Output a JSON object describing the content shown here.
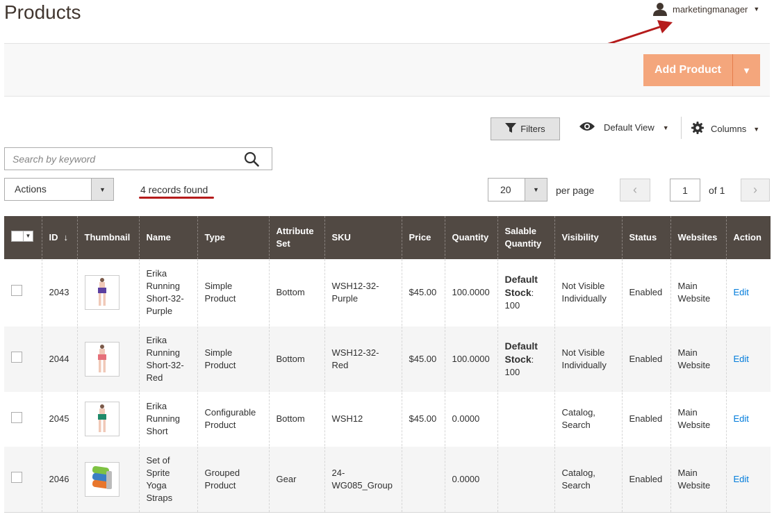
{
  "header": {
    "title": "Products",
    "username": "marketingmanager"
  },
  "actionbar": {
    "add_product_label": "Add Product"
  },
  "toolbar": {
    "filters_label": "Filters",
    "view_label": "Default View",
    "columns_label": "Columns"
  },
  "search": {
    "placeholder": "Search by keyword"
  },
  "mass_actions": {
    "label": "Actions"
  },
  "records_found": "4 records found",
  "pager": {
    "per_page_value": "20",
    "per_page_label": "per page",
    "current_page": "1",
    "of_label": "of 1"
  },
  "grid": {
    "columns": [
      "ID",
      "Thumbnail",
      "Name",
      "Type",
      "Attribute Set",
      "SKU",
      "Price",
      "Quantity",
      "Salable Quantity",
      "Visibility",
      "Status",
      "Websites",
      "Action"
    ],
    "sort_column": "ID",
    "sort_direction": "descending-arrow",
    "rows": [
      {
        "id": "2043",
        "thumbnail": "purple-shorts",
        "name": "Erika Running Short-32-Purple",
        "type": "Simple Product",
        "attribute_set": "Bottom",
        "sku": "WSH12-32-Purple",
        "price": "$45.00",
        "quantity": "100.0000",
        "salable_label": "Default Stock",
        "salable_sep": ":",
        "salable_value": "100",
        "visibility": "Not Visible Individually",
        "status": "Enabled",
        "websites": "Main Website",
        "action": "Edit"
      },
      {
        "id": "2044",
        "thumbnail": "red-shorts",
        "name": "Erika Running Short-32-Red",
        "type": "Simple Product",
        "attribute_set": "Bottom",
        "sku": "WSH12-32-Red",
        "price": "$45.00",
        "quantity": "100.0000",
        "salable_label": "Default Stock",
        "salable_sep": ":",
        "salable_value": "100",
        "visibility": "Not Visible Individually",
        "status": "Enabled",
        "websites": "Main Website",
        "action": "Edit"
      },
      {
        "id": "2045",
        "thumbnail": "green-shorts",
        "name": "Erika Running Short",
        "type": "Configurable Product",
        "attribute_set": "Bottom",
        "sku": "WSH12",
        "price": "$45.00",
        "quantity": "0.0000",
        "salable_label": "",
        "salable_sep": "",
        "salable_value": "",
        "visibility": "Catalog, Search",
        "status": "Enabled",
        "websites": "Main Website",
        "action": "Edit"
      },
      {
        "id": "2046",
        "thumbnail": "yoga-straps",
        "name": "Set of Sprite Yoga Straps",
        "type": "Grouped Product",
        "attribute_set": "Gear",
        "sku": "24-WG085_Group",
        "price": "",
        "quantity": "0.0000",
        "salable_label": "",
        "salable_sep": "",
        "salable_value": "",
        "visibility": "Catalog, Search",
        "status": "Enabled",
        "websites": "Main Website",
        "action": "Edit"
      }
    ]
  },
  "colors": {
    "header_bg": "#514943",
    "accent": "#f4a67c",
    "link": "#007bdb",
    "annotation": "#b51b1b"
  }
}
